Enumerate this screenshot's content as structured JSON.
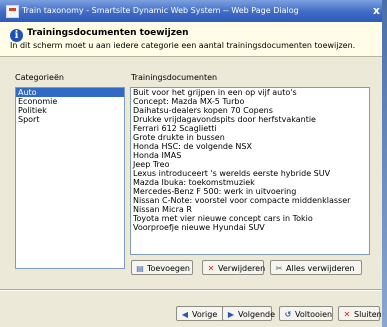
{
  "window": {
    "title": "Train taxonomy - Smartsite Dynamic Web System -- Web Page Dialog",
    "close_glyph": "x"
  },
  "info": {
    "icon": "info-icon",
    "heading": "Trainingsdocumenten toewijzen",
    "description": "In dit scherm moet u aan iedere categorie een aantal trainingsdocumenten toewijzen."
  },
  "categories": {
    "label": "Categorieën",
    "items": [
      "Auto",
      "Economie",
      "Politiek",
      "Sport"
    ],
    "selected": "Auto"
  },
  "documents": {
    "label": "Trainingsdocumenten",
    "items": [
      "Buit voor het grijpen in een op vijf auto's",
      "Concept: Mazda MX-5 Turbo",
      "Daihatsu-dealers kopen 70 Copens",
      "Drukke vrijdagavondspits door herfstvakantie",
      "Ferrari 612 Scaglietti",
      "Grote drukte in bussen",
      "Honda HSC: de volgende NSX",
      "Honda IMAS",
      "Jeep Treo",
      "Lexus introduceert 's werelds eerste hybride SUV",
      "Mazda Ibuka: toekomstmuziek",
      "Mercedes-Benz F 500: werk in uitvoering",
      "Nissan C-Note: voorstel voor compacte middenklasser",
      "Nissan Micra R",
      "Toyota met vier nieuwe concept cars in Tokio",
      "Voorproefje nieuwe Hyundai SUV"
    ]
  },
  "actions": {
    "add": "Toevoegen",
    "remove": "Verwijderen",
    "remove_all": "Alles verwijderen"
  },
  "footer": {
    "previous": "Vorige",
    "next": "Volgende",
    "finish": "Voltooien",
    "close": "Sluiten"
  }
}
